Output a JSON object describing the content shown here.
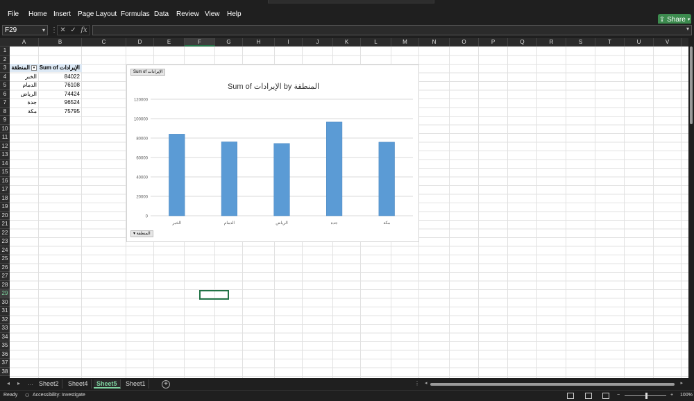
{
  "menu": {
    "items": [
      "File",
      "Home",
      "Insert",
      "Page Layout",
      "Formulas",
      "Data",
      "Review",
      "View",
      "Help"
    ],
    "share_label": "Share"
  },
  "formula_bar": {
    "name_box": "F29",
    "fx_label": "fx",
    "formula": ""
  },
  "grid": {
    "columns": [
      "A",
      "B",
      "C",
      "D",
      "E",
      "F",
      "G",
      "H",
      "I",
      "J",
      "K",
      "L",
      "M",
      "N",
      "O",
      "P",
      "Q",
      "R",
      "S",
      "T",
      "U",
      "V"
    ],
    "rows": [
      "1",
      "2",
      "3",
      "4",
      "5",
      "6",
      "7",
      "8",
      "9",
      "10",
      "11",
      "12",
      "13",
      "14",
      "15",
      "16",
      "17",
      "18",
      "19",
      "20",
      "21",
      "22",
      "23",
      "24",
      "25",
      "26",
      "27",
      "28",
      "29",
      "30",
      "31",
      "32",
      "33",
      "34",
      "35",
      "36",
      "37",
      "38"
    ],
    "selected_column": "F",
    "selected_row": "29"
  },
  "pivot": {
    "row_header": "المنطقة",
    "value_header": "Sum of الإيرادات",
    "rows": [
      {
        "region": "الخبر",
        "value": "84022"
      },
      {
        "region": "الدمام",
        "value": "76108"
      },
      {
        "region": "الرياض",
        "value": "74424"
      },
      {
        "region": "جدة",
        "value": "96524"
      },
      {
        "region": "مكة",
        "value": "75795"
      }
    ]
  },
  "chart": {
    "value_field_button": "Sum of الإيرادات",
    "axis_field_button": "المنطقة"
  },
  "chart_data": {
    "type": "bar",
    "title": "Sum of الإيرادات by المنطقة",
    "categories": [
      "الخبر",
      "الدمام",
      "الرياض",
      "جدة",
      "مكة"
    ],
    "values": [
      84022,
      76108,
      74424,
      96524,
      75795
    ],
    "y_ticks": [
      "0",
      "20000",
      "40000",
      "60000",
      "80000",
      "100000",
      "120000"
    ],
    "ylim": [
      0,
      120000
    ],
    "grid": true,
    "legend": "none",
    "bar_color": "#5b9bd5"
  },
  "sheets": {
    "tabs": [
      "Sheet2",
      "Sheet4",
      "Sheet5",
      "Sheet1"
    ],
    "active": "Sheet5"
  },
  "status": {
    "ready": "Ready",
    "accessibility": "Accessibility: Investigate",
    "zoom": "100%"
  },
  "colors": {
    "accent": "#217346",
    "share": "#3c8a4e"
  }
}
